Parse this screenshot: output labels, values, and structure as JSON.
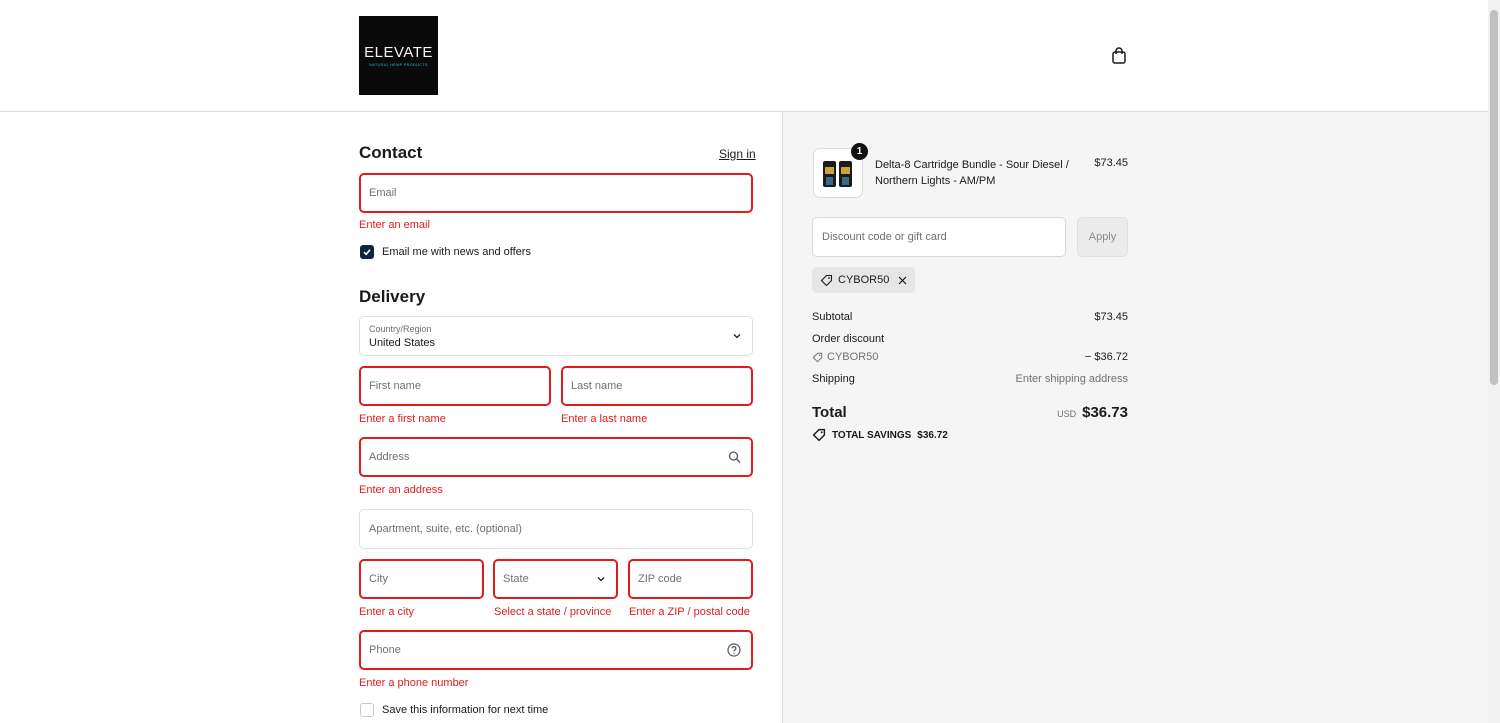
{
  "header": {
    "logo": {
      "main": "ELEVATE",
      "sub": "NATURAL HEMP PRODUCTS"
    },
    "cart_icon": "shopping-bag-icon"
  },
  "contact": {
    "title": "Contact",
    "sign_in": "Sign in",
    "email_placeholder": "Email",
    "email_error": "Enter an email",
    "news_checkbox_label": "Email me with news and offers",
    "news_checked": true
  },
  "delivery": {
    "title": "Delivery",
    "country_label": "Country/Region",
    "country_value": "United States",
    "first_name_placeholder": "First name",
    "first_name_error": "Enter a first name",
    "last_name_placeholder": "Last name",
    "last_name_error": "Enter a last name",
    "address_placeholder": "Address",
    "address_error": "Enter an address",
    "apartment_placeholder": "Apartment, suite, etc. (optional)",
    "city_placeholder": "City",
    "city_error": "Enter a city",
    "state_placeholder": "State",
    "state_error": "Select a state / province",
    "zip_placeholder": "ZIP code",
    "zip_error": "Enter a ZIP / postal code",
    "phone_placeholder": "Phone",
    "phone_error": "Enter a phone number",
    "save_info_label": "Save this information for next time",
    "save_info_checked": false
  },
  "order": {
    "product": {
      "name": "Delta-8 Cartridge Bundle - Sour Diesel / Northern Lights - AM/PM",
      "price": "$73.45",
      "quantity": "1"
    },
    "discount_placeholder": "Discount code or gift card",
    "apply_label": "Apply",
    "applied_code": "CYBOR50",
    "subtotal_label": "Subtotal",
    "subtotal_value": "$73.45",
    "order_discount_label": "Order discount",
    "discount_code": "CYBOR50",
    "discount_value": "− $36.72",
    "shipping_label": "Shipping",
    "shipping_value": "Enter shipping address",
    "total_label": "Total",
    "currency": "USD",
    "total_value": "$36.73",
    "savings_label": "TOTAL SAVINGS",
    "savings_value": "$36.72"
  },
  "colors": {
    "error": "#dd1d1d",
    "checkbox": "#10233f",
    "summary_bg": "#f5f5f5",
    "logo_accent": "#2fb3d1"
  }
}
